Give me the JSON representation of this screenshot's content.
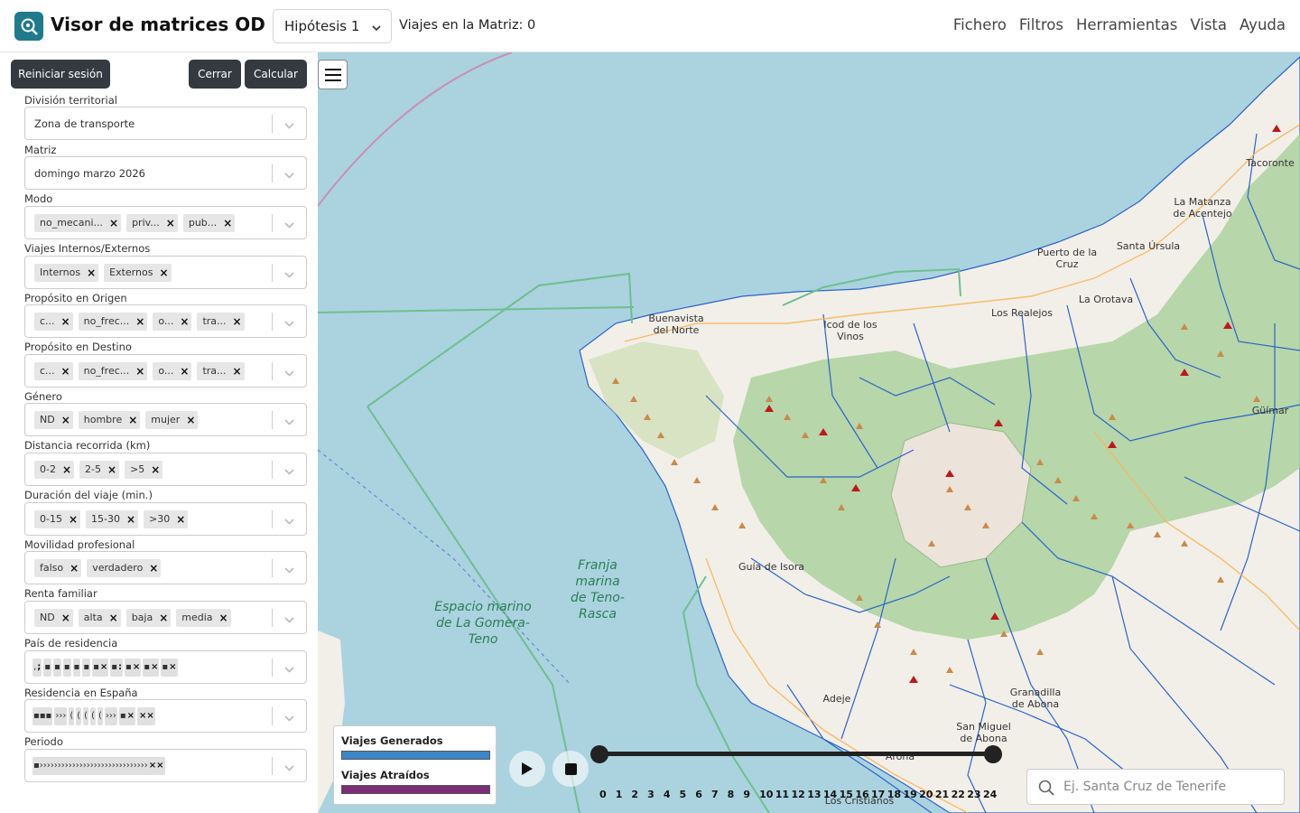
{
  "header": {
    "title": "Visor de matrices OD",
    "hypothesis": "Hipótesis 1",
    "trips_label": "Viajes en la Matriz: 0",
    "menu": [
      "Fichero",
      "Filtros",
      "Herramientas",
      "Vista",
      "Ayuda"
    ]
  },
  "sidebar": {
    "reset_label": "Reiniciar sesión",
    "close_label": "Cerrar",
    "calc_label": "Calcular",
    "fields": {
      "division": {
        "label": "División territorial",
        "value": "Zona de transporte"
      },
      "matrix": {
        "label": "Matriz",
        "value": "domingo marzo 2026"
      },
      "mode": {
        "label": "Modo",
        "chips": [
          "no_mecani...",
          "priv...",
          "pub..."
        ]
      },
      "internal": {
        "label": "Viajes Internos/Externos",
        "chips": [
          "Internos",
          "Externos"
        ]
      },
      "purpose_origin": {
        "label": "Propósito en Origen",
        "chips": [
          "c...",
          "no_frec...",
          "o...",
          "tra..."
        ]
      },
      "purpose_dest": {
        "label": "Propósito en Destino",
        "chips": [
          "c...",
          "no_frec...",
          "o...",
          "tra..."
        ]
      },
      "gender": {
        "label": "Género",
        "chips": [
          "ND",
          "hombre",
          "mujer"
        ]
      },
      "distance": {
        "label": "Distancia recorrida (km)",
        "chips": [
          "0-2",
          "2-5",
          ">5"
        ]
      },
      "duration": {
        "label": "Duración del viaje (min.)",
        "chips": [
          "0-15",
          "15-30",
          ">30"
        ]
      },
      "professional": {
        "label": "Movilidad profesional",
        "chips": [
          "falso",
          "verdadero"
        ]
      },
      "income": {
        "label": "Renta familiar",
        "chips": [
          "ND",
          "alta",
          "baja",
          "media"
        ]
      },
      "country": {
        "label": "País de residencia"
      },
      "residence": {
        "label": "Residencia en España"
      },
      "period": {
        "label": "Periodo"
      }
    }
  },
  "map": {
    "legend": {
      "generated": "Viajes Generados",
      "attracted": "Viajes Atraídos",
      "generated_color": "#3d87c9",
      "attracted_color": "#7b2d77"
    },
    "hours": [
      "0",
      "1",
      "2",
      "3",
      "4",
      "5",
      "6",
      "7",
      "8",
      "9",
      "10",
      "11",
      "12",
      "13",
      "14",
      "15",
      "16",
      "17",
      "18",
      "19",
      "20",
      "21",
      "22",
      "23",
      "24"
    ],
    "search_placeholder": "Ej. Santa Cruz de Tenerife",
    "labels": {
      "buenavista": "Buenavista del Norte",
      "icod": "Icod de los Vinos",
      "puerto": "Puerto de la Cruz",
      "orotava": "La Orotava",
      "realejos": "Los Realejos",
      "matanza": "La Matanza de Acentejo",
      "ursula": "Santa Úrsula",
      "tacoronte": "Tacoronte",
      "guimar": "Güímar",
      "guia": "Guía de Isora",
      "granadilla": "Granadilla de Abona",
      "sanmiguel": "San Miguel de Abona",
      "arona": "Arona",
      "cristianos": "Los Cristianos",
      "adeje": "Adeje"
    },
    "sea_labels": {
      "teno": "Franja marina de Teno-Rasca",
      "gomera": "Espacio marino de La Gomera-Teno"
    }
  }
}
